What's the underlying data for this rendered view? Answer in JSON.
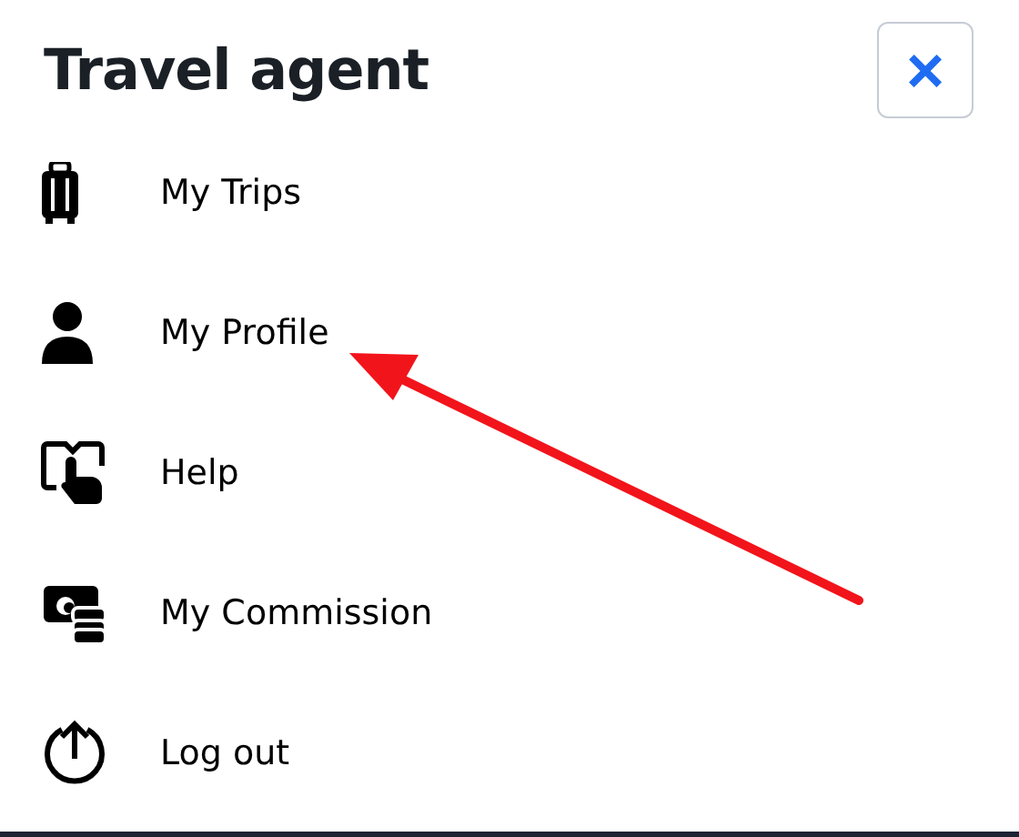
{
  "header": {
    "title": "Travel agent",
    "close_label": "×"
  },
  "menu": [
    {
      "label": "My Trips",
      "kind": "suitcase"
    },
    {
      "label": "My Profile",
      "kind": "person"
    },
    {
      "label": "Help",
      "kind": "help"
    },
    {
      "label": "My Commission",
      "kind": "money"
    },
    {
      "label": "Log out",
      "kind": "logout"
    }
  ]
}
